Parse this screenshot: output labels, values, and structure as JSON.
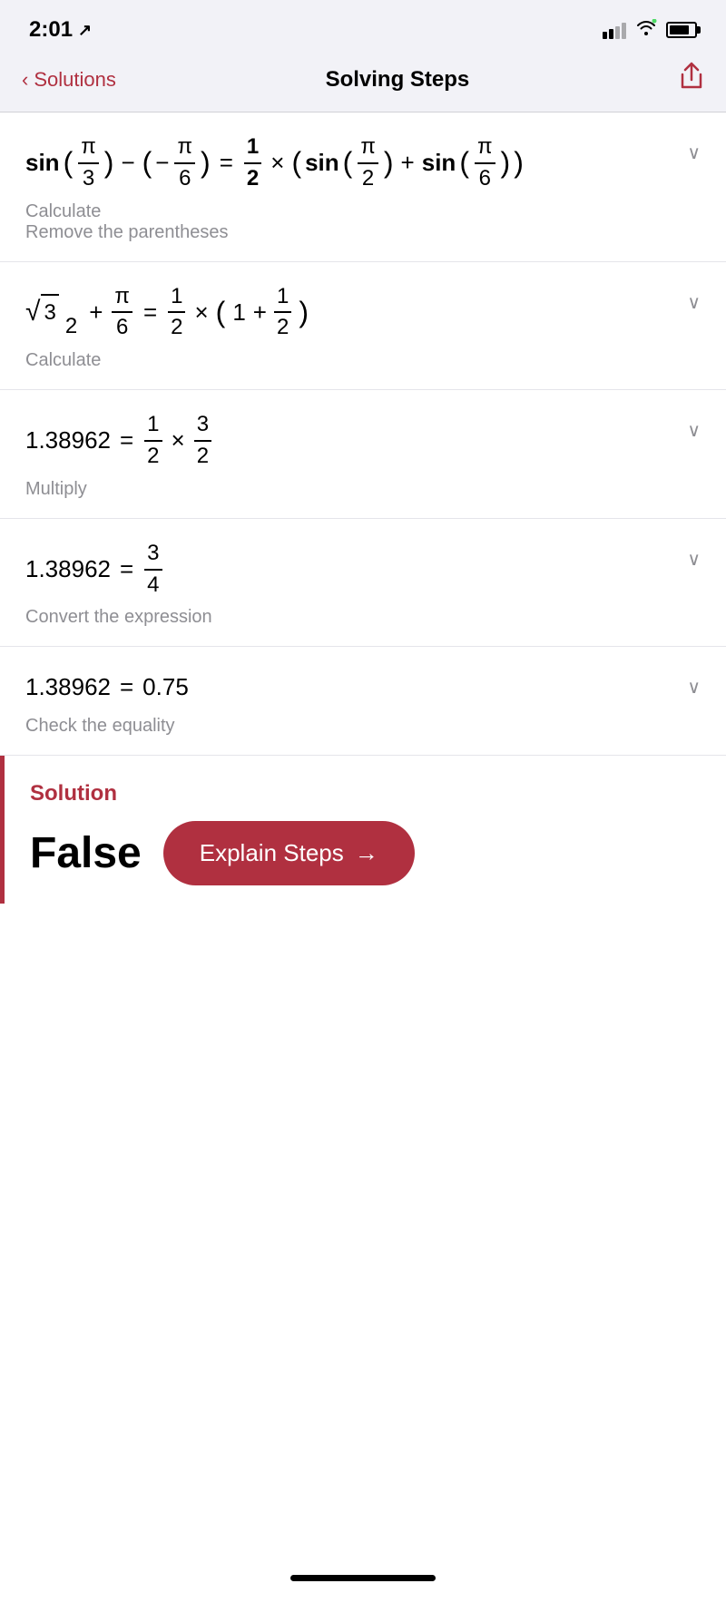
{
  "statusBar": {
    "time": "2:01",
    "navArrow": "◂"
  },
  "navBar": {
    "backLabel": "Solutions",
    "title": "Solving Steps",
    "shareIcon": "share"
  },
  "steps": [
    {
      "id": "step1",
      "label": "Calculate\nRemove the parentheses",
      "equationHtml": "step1"
    },
    {
      "id": "step2",
      "label": "Calculate",
      "equationHtml": "step2"
    },
    {
      "id": "step3",
      "label": "Multiply",
      "equationHtml": "step3"
    },
    {
      "id": "step4",
      "label": "Convert the expression",
      "equationHtml": "step4"
    },
    {
      "id": "step5",
      "label": "Check the equality",
      "equationHtml": "step5"
    }
  ],
  "solution": {
    "label": "Solution",
    "value": "False",
    "buttonLabel": "Explain Steps",
    "buttonArrow": "→"
  }
}
